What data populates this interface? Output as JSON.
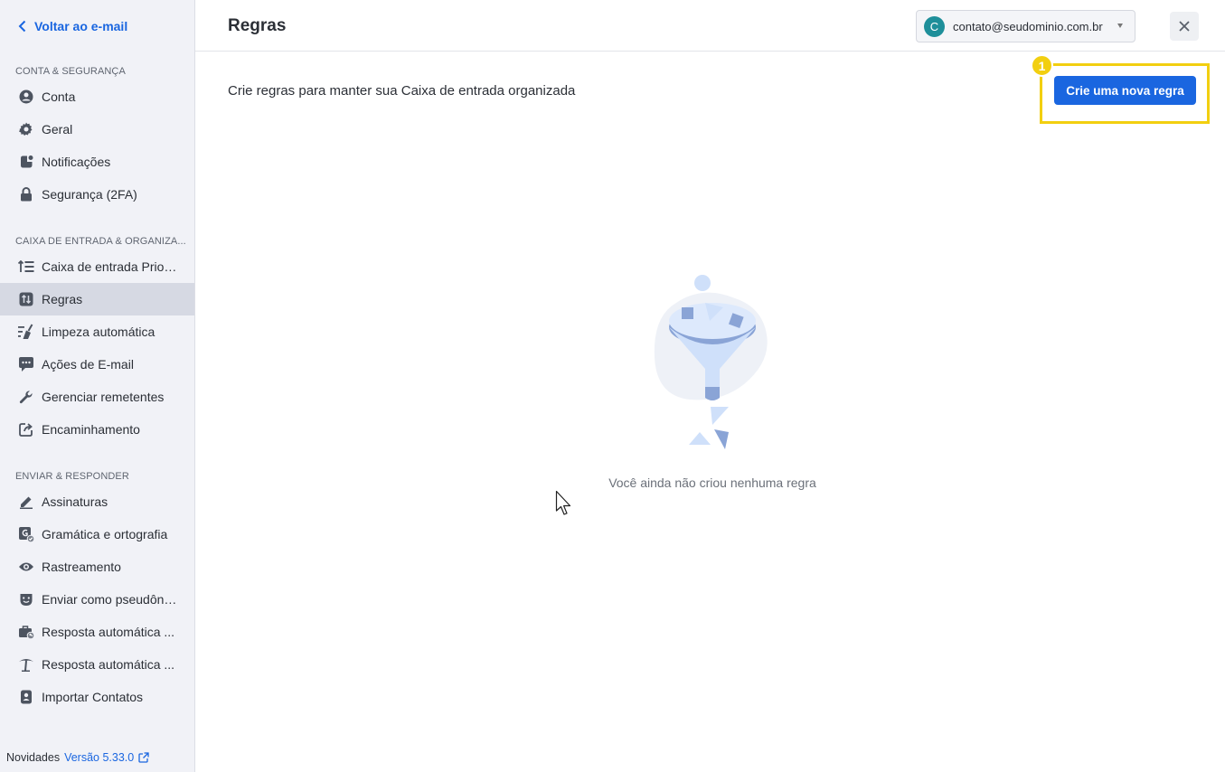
{
  "sidebar": {
    "back_label": "Voltar ao e-mail",
    "sections": [
      {
        "title": "CONTA & SEGURANÇA",
        "items": [
          {
            "label": "Conta",
            "icon": "user-icon"
          },
          {
            "label": "Geral",
            "icon": "gear-icon"
          },
          {
            "label": "Notificações",
            "icon": "notification-icon"
          },
          {
            "label": "Segurança (2FA)",
            "icon": "lock-icon"
          }
        ]
      },
      {
        "title": "CAIXA DE ENTRADA & ORGANIZA...",
        "items": [
          {
            "label": "Caixa de entrada Prior...",
            "icon": "priority-list-icon"
          },
          {
            "label": "Regras",
            "icon": "rules-icon",
            "active": true
          },
          {
            "label": "Limpeza automática",
            "icon": "broom-icon"
          },
          {
            "label": "Ações de E-mail",
            "icon": "chat-actions-icon"
          },
          {
            "label": "Gerenciar remetentes",
            "icon": "wrench-icon"
          },
          {
            "label": "Encaminhamento",
            "icon": "forward-icon"
          }
        ]
      },
      {
        "title": "ENVIAR & RESPONDER",
        "items": [
          {
            "label": "Assinaturas",
            "icon": "pen-icon"
          },
          {
            "label": "Gramática e ortografia",
            "icon": "grammar-icon"
          },
          {
            "label": "Rastreamento",
            "icon": "eye-icon"
          },
          {
            "label": "Enviar como pseudôni...",
            "icon": "mask-icon"
          },
          {
            "label": "Resposta automática ...",
            "icon": "briefcase-reply-icon"
          },
          {
            "label": "Resposta automática ...",
            "icon": "palm-tree-icon"
          },
          {
            "label": "Importar Contatos",
            "icon": "contacts-icon"
          }
        ]
      }
    ],
    "footer": {
      "label": "Novidades",
      "version": "Versão 5.33.0",
      "icon": "external-link-icon"
    }
  },
  "header": {
    "title": "Regras",
    "account_initial": "C",
    "account_email": "contato@seudominio.com.br"
  },
  "main": {
    "subtitle": "Crie regras para manter sua Caixa de entrada organizada",
    "badge": "1",
    "new_rule_button": "Crie uma nova regra",
    "empty_state": "Você ainda não criou nenhuma regra"
  },
  "colors": {
    "accent": "#1a66e0",
    "highlight": "#f2cf10",
    "avatar": "#1e8f9a"
  }
}
